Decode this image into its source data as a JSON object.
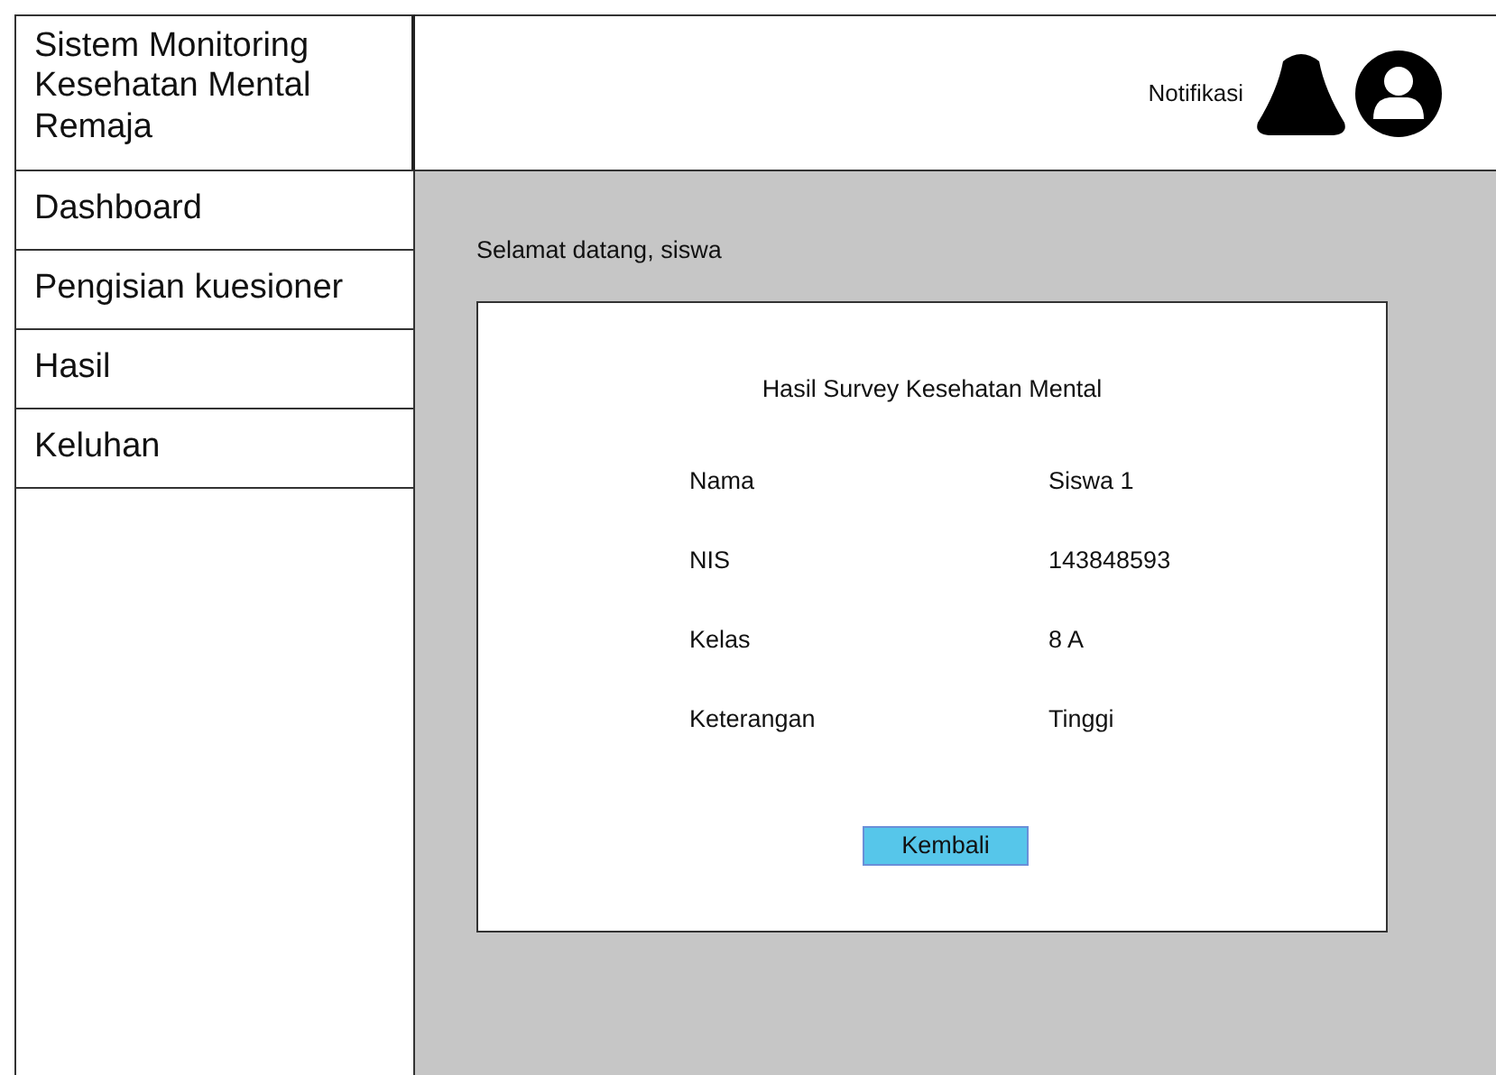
{
  "app_title": "Sistem Monitoring Kesehatan Mental Remaja",
  "header": {
    "notification_label": "Notifikasi"
  },
  "sidebar": {
    "items": [
      {
        "label": "Dashboard"
      },
      {
        "label": "Pengisian kuesioner"
      },
      {
        "label": "Hasil"
      },
      {
        "label": "Keluhan"
      }
    ]
  },
  "greeting": "Selamat datang, siswa",
  "result_card": {
    "title": "Hasil Survey Kesehatan Mental",
    "rows": [
      {
        "label": "Nama",
        "value": "Siswa 1"
      },
      {
        "label": "NIS",
        "value": "143848593"
      },
      {
        "label": "Kelas",
        "value": "8 A"
      },
      {
        "label": "Keterangan",
        "value": "Tinggi"
      }
    ],
    "button": "Kembali"
  }
}
